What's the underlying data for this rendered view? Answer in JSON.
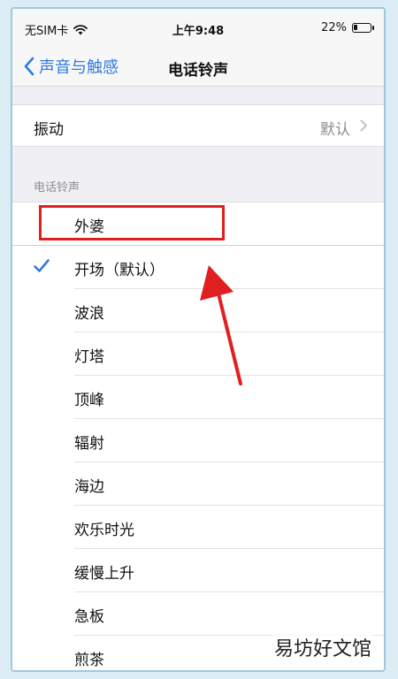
{
  "status_bar": {
    "carrier": "无SIM卡",
    "time": "上午9:48",
    "battery": "22%",
    "battery_level": 0.22
  },
  "nav": {
    "back_label": "声音与触感",
    "title": "电话铃声"
  },
  "vibration": {
    "label": "振动",
    "value": "默认"
  },
  "ringtones": {
    "section_header": "电话铃声",
    "items": [
      {
        "label": "外婆",
        "selected": false
      },
      {
        "label": "开场（默认）",
        "selected": true
      },
      {
        "label": "波浪",
        "selected": false
      },
      {
        "label": "灯塔",
        "selected": false
      },
      {
        "label": "顶峰",
        "selected": false
      },
      {
        "label": "辐射",
        "selected": false
      },
      {
        "label": "海边",
        "selected": false
      },
      {
        "label": "欢乐时光",
        "selected": false
      },
      {
        "label": "缓慢上升",
        "selected": false
      },
      {
        "label": "急板",
        "selected": false
      },
      {
        "label": "煎茶",
        "selected": false
      }
    ]
  },
  "watermark": "易坊好文馆",
  "colors": {
    "accent": "#2f7be0",
    "highlight": "#e02020"
  }
}
